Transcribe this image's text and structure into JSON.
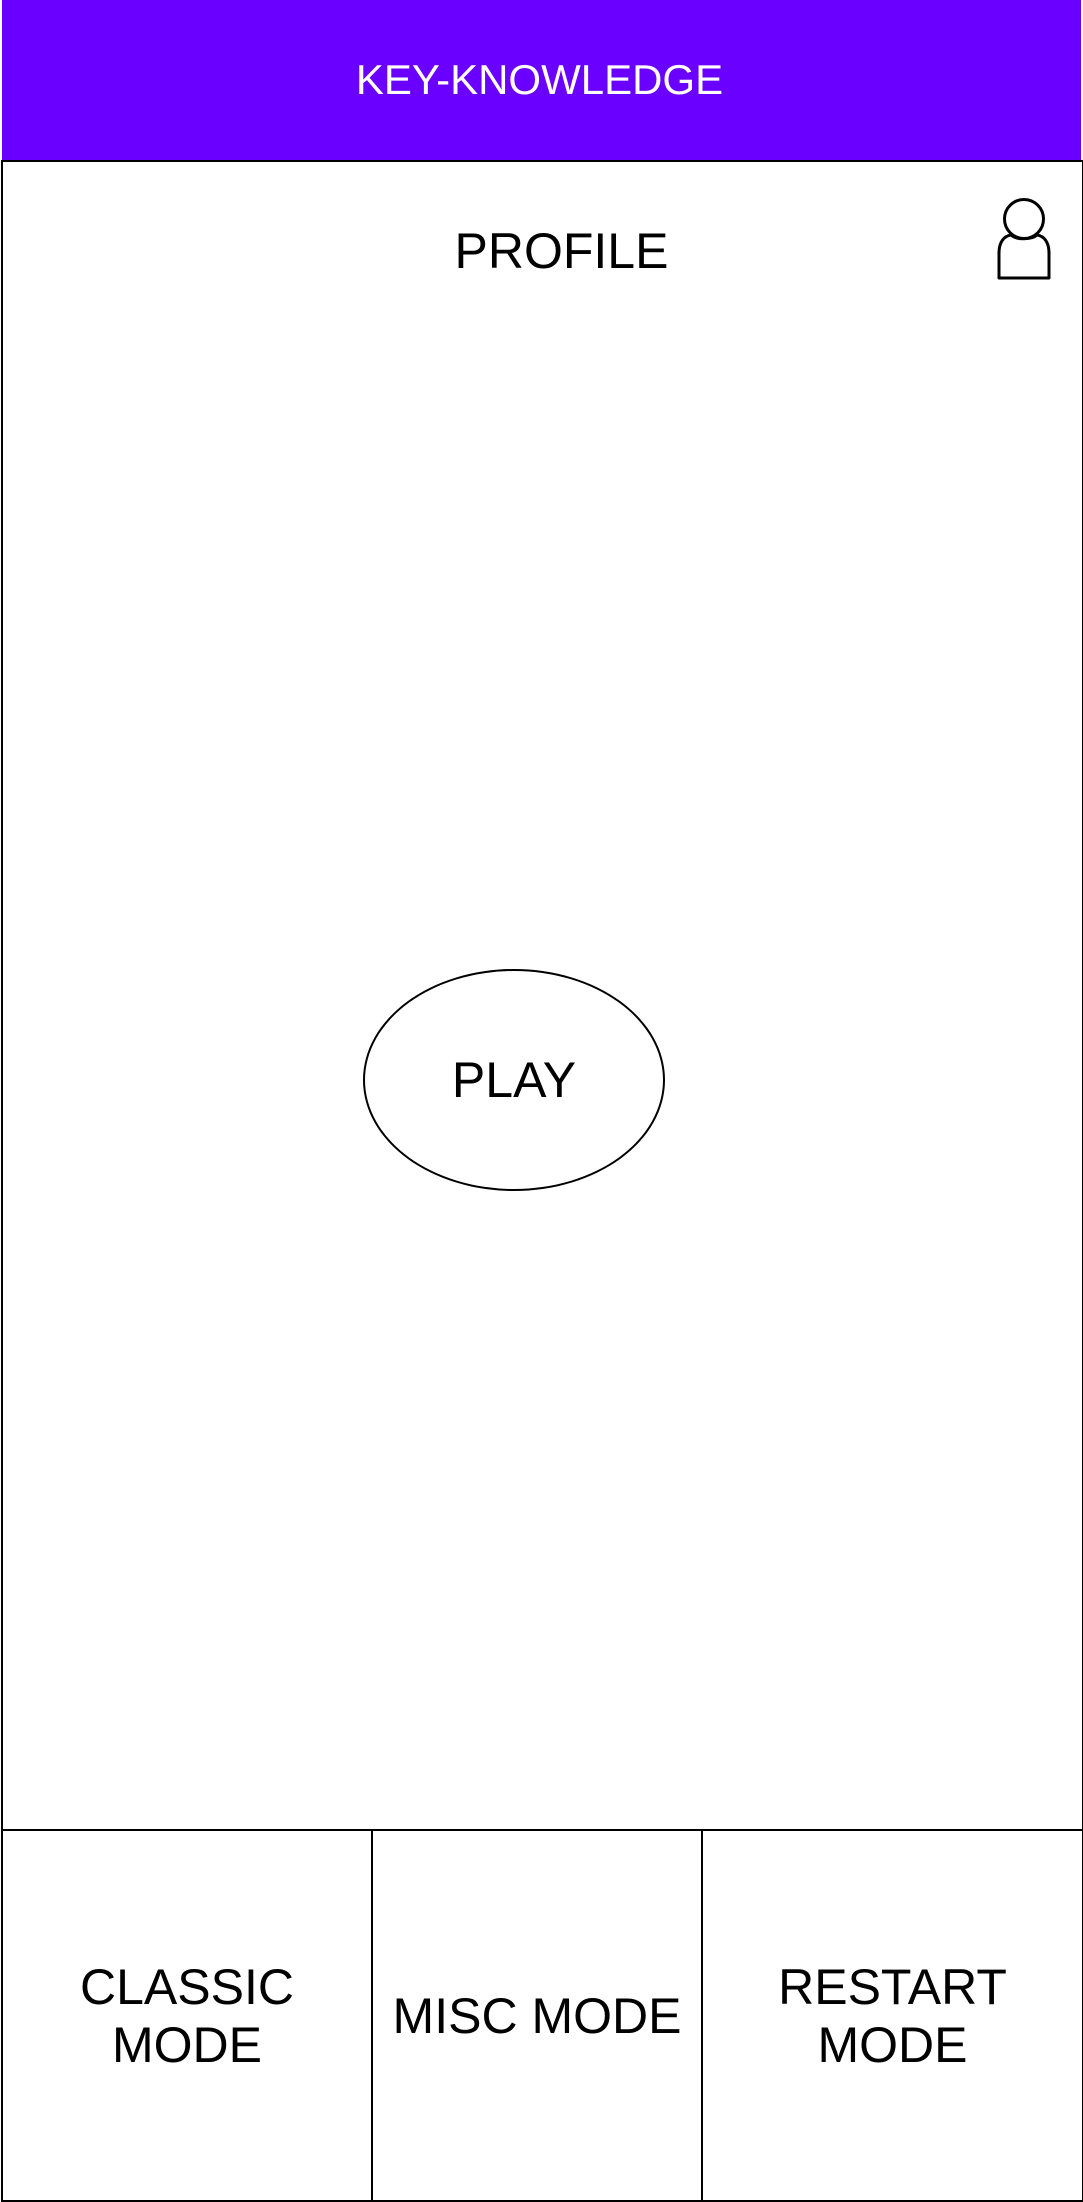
{
  "header": {
    "title": "KEY-KNOWLEDGE",
    "background_color": "#6a00ff"
  },
  "profile_bar": {
    "title": "PROFILE",
    "icon": "user-profile-icon"
  },
  "main": {
    "play_label": "PLAY"
  },
  "bottom_nav": {
    "items": [
      {
        "line1": "CLASSIC",
        "line2": "MODE"
      },
      {
        "line1": "MISC MODE"
      },
      {
        "line1": "RESTART",
        "line2": "MODE"
      }
    ]
  }
}
